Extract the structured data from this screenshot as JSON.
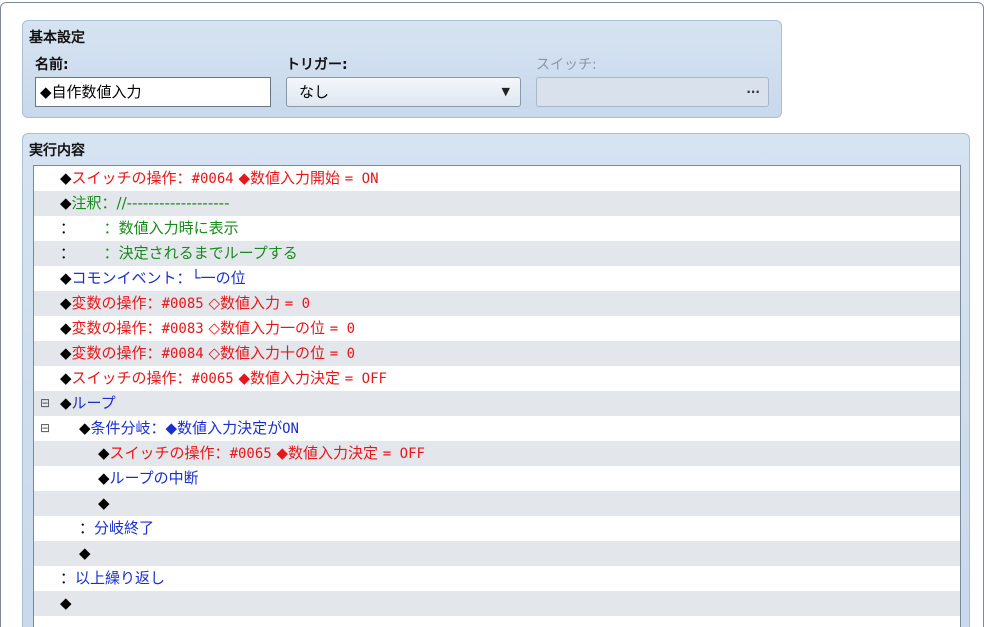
{
  "settings": {
    "title": "基本設定",
    "name_label": "名前:",
    "name_value": "◆自作数値入力",
    "trigger_label": "トリガー:",
    "trigger_value": "なし",
    "switch_label": "スイッチ:",
    "switch_button": "..."
  },
  "content": {
    "title": "実行内容",
    "rows": [
      {
        "toggle": "",
        "indent": 1,
        "parts": [
          [
            "c-black",
            "◆"
          ],
          [
            "c-red",
            "スイッチの操作："
          ],
          [
            "c-red mono",
            "#0064"
          ],
          [
            "c-red",
            " ◆数値入力開始 "
          ],
          [
            "c-red mono",
            "= ON"
          ]
        ]
      },
      {
        "toggle": "",
        "indent": 1,
        "parts": [
          [
            "c-black",
            "◆"
          ],
          [
            "c-green",
            "注釈：//-------------------"
          ]
        ]
      },
      {
        "toggle": "",
        "indent": 1,
        "parts": [
          [
            "c-black",
            "："
          ],
          [
            "c-green",
            "      ：数値入力時に表示"
          ]
        ]
      },
      {
        "toggle": "",
        "indent": 1,
        "parts": [
          [
            "c-black",
            "："
          ],
          [
            "c-green",
            "      ：決定されるまでループする"
          ]
        ]
      },
      {
        "toggle": "",
        "indent": 1,
        "parts": [
          [
            "c-black",
            "◆"
          ],
          [
            "c-blue",
            "コモンイベント：└一の位"
          ]
        ]
      },
      {
        "toggle": "",
        "indent": 1,
        "parts": [
          [
            "c-black",
            "◆"
          ],
          [
            "c-red",
            "変数の操作："
          ],
          [
            "c-red mono",
            "#0085"
          ],
          [
            "c-red",
            " ◇数値入力 "
          ],
          [
            "c-red mono",
            "= 0"
          ]
        ]
      },
      {
        "toggle": "",
        "indent": 1,
        "parts": [
          [
            "c-black",
            "◆"
          ],
          [
            "c-red",
            "変数の操作："
          ],
          [
            "c-red mono",
            "#0083"
          ],
          [
            "c-red",
            " ◇数値入力一の位 "
          ],
          [
            "c-red mono",
            "= 0"
          ]
        ]
      },
      {
        "toggle": "",
        "indent": 1,
        "parts": [
          [
            "c-black",
            "◆"
          ],
          [
            "c-red",
            "変数の操作："
          ],
          [
            "c-red mono",
            "#0084"
          ],
          [
            "c-red",
            " ◇数値入力十の位 "
          ],
          [
            "c-red mono",
            "= 0"
          ]
        ]
      },
      {
        "toggle": "",
        "indent": 1,
        "parts": [
          [
            "c-black",
            "◆"
          ],
          [
            "c-red",
            "スイッチの操作："
          ],
          [
            "c-red mono",
            "#0065"
          ],
          [
            "c-red",
            " ◆数値入力決定 "
          ],
          [
            "c-red mono",
            "= OFF"
          ]
        ]
      },
      {
        "toggle": "⊟",
        "indent": 1,
        "parts": [
          [
            "c-black",
            "◆"
          ],
          [
            "c-blue",
            "ループ"
          ]
        ]
      },
      {
        "toggle": "⊟",
        "indent": 2,
        "parts": [
          [
            "c-black",
            "◆"
          ],
          [
            "c-blue",
            "条件分岐：◆数値入力決定が"
          ],
          [
            "c-blue mono",
            "ON"
          ]
        ]
      },
      {
        "toggle": "",
        "indent": 3,
        "parts": [
          [
            "c-black",
            "◆"
          ],
          [
            "c-red",
            "スイッチの操作："
          ],
          [
            "c-red mono",
            "#0065"
          ],
          [
            "c-red",
            " ◆数値入力決定 "
          ],
          [
            "c-red mono",
            "= OFF"
          ]
        ]
      },
      {
        "toggle": "",
        "indent": 3,
        "parts": [
          [
            "c-black",
            "◆"
          ],
          [
            "c-blue",
            "ループの中断"
          ]
        ]
      },
      {
        "toggle": "",
        "indent": 3,
        "parts": [
          [
            "c-black",
            "◆"
          ]
        ]
      },
      {
        "toggle": "",
        "indent": 2,
        "parts": [
          [
            "c-black",
            "："
          ],
          [
            "c-blue",
            "分岐終了"
          ]
        ]
      },
      {
        "toggle": "",
        "indent": 2,
        "parts": [
          [
            "c-black",
            "◆"
          ]
        ]
      },
      {
        "toggle": "",
        "indent": 1,
        "parts": [
          [
            "c-black",
            "："
          ],
          [
            "c-blue",
            "以上繰り返し"
          ]
        ]
      },
      {
        "toggle": "",
        "indent": 1,
        "parts": [
          [
            "c-black",
            "◆"
          ]
        ]
      }
    ]
  }
}
